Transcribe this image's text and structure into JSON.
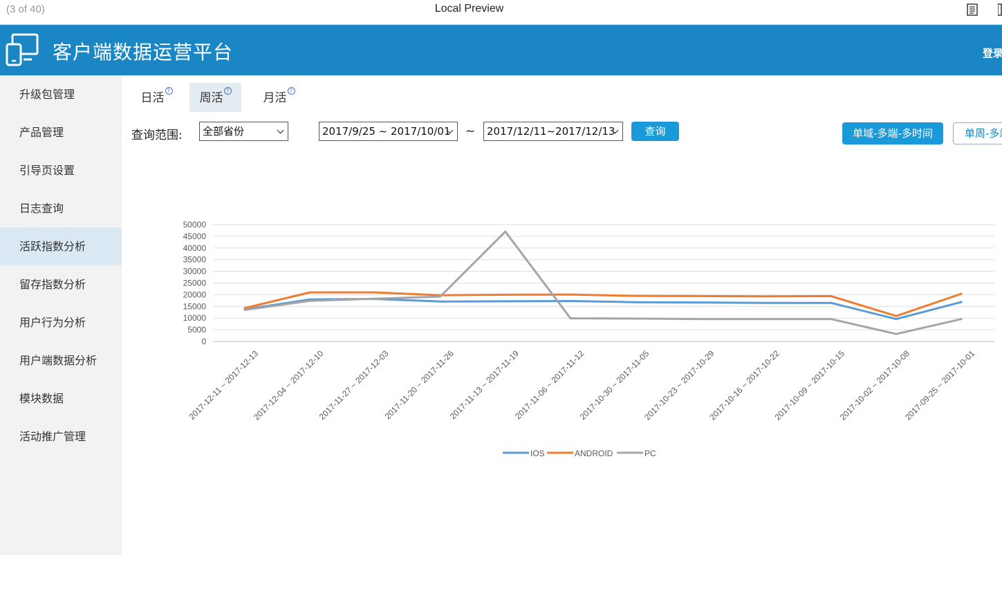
{
  "preview": {
    "counter": "(3 of 40)",
    "title": "Local Preview"
  },
  "header": {
    "title": "客户端数据运营平台",
    "login": "登录"
  },
  "sidebar": {
    "items": [
      {
        "label": "升级包管理"
      },
      {
        "label": "产品管理"
      },
      {
        "label": "引导页设置"
      },
      {
        "label": "日志查询"
      },
      {
        "label": "活跃指数分析",
        "active": true
      },
      {
        "label": "留存指数分析"
      },
      {
        "label": "用户行为分析"
      },
      {
        "label": "用户端数据分析"
      },
      {
        "label": "模块数据"
      },
      {
        "label": "活动推广管理"
      }
    ]
  },
  "tabs": [
    {
      "label": "日活",
      "help": "?"
    },
    {
      "label": "周活",
      "help": "?",
      "active": true
    },
    {
      "label": "月活",
      "help": "?"
    }
  ],
  "query": {
    "range_label": "查询范围:",
    "province": "全部省份",
    "start": "2017/9/25 ~ 2017/10/01",
    "separator": "~",
    "end": "2017/12/11~2017/12/13",
    "submit": "查询"
  },
  "modes": {
    "primary": "单域-多端-多时间",
    "secondary": "单周-多端"
  },
  "colors": {
    "accent": "#1a86c3",
    "ios": "#5b9bd5",
    "android": "#ed7d31",
    "pc": "#a5a5a5"
  },
  "chart_data": {
    "type": "line",
    "x": [
      "2017-12-11 ~ 2017-12-13",
      "2017-12-04 ~ 2017-12-10",
      "2017-11-27 ~ 2017-12-03",
      "2017-11-20 ~ 2017-11-26",
      "2017-11-13 ~ 2017-11-19",
      "2017-11-06 ~ 2017-11-12",
      "2017-10-30 ~ 2017-11-05",
      "2017-10-23 ~ 2017-10-29",
      "2017-10-16 ~ 2017-10-22",
      "2017-10-09 ~ 2017-10-15",
      "2017-10-02 ~ 2017-10-08",
      "2017-09-25 ~ 2017-10-01"
    ],
    "series": [
      {
        "name": "IOS",
        "color": "#5b9bd5",
        "values": [
          13800,
          18000,
          18200,
          17100,
          17200,
          17300,
          16800,
          16700,
          16500,
          16500,
          9600,
          16900
        ]
      },
      {
        "name": "ANDROID",
        "color": "#ed7d31",
        "values": [
          14300,
          21000,
          21000,
          19800,
          20000,
          20100,
          19500,
          19400,
          19300,
          19400,
          10900,
          20400
        ]
      },
      {
        "name": "PC",
        "color": "#a5a5a5",
        "values": [
          13500,
          17400,
          18300,
          19200,
          47000,
          9900,
          9800,
          9600,
          9600,
          9600,
          3200,
          9600
        ]
      }
    ],
    "yticks": [
      "50000",
      "45000",
      "40000",
      "35000",
      "30000",
      "25000",
      "20000",
      "15000",
      "10000",
      "5000",
      "0"
    ],
    "ylim": [
      0,
      50000
    ],
    "grid": true,
    "legend": "bottom"
  }
}
